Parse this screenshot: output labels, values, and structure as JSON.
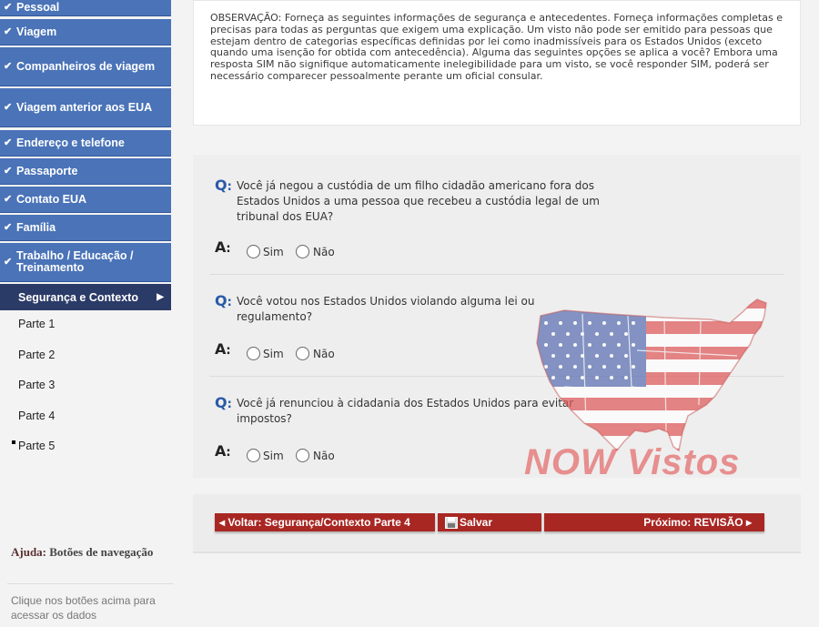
{
  "sidebar": {
    "completed": [
      {
        "label": "Pessoal"
      },
      {
        "label": "Viagem"
      },
      {
        "label": "Companheiros de viagem"
      },
      {
        "label": "Viagem anterior aos EUA"
      },
      {
        "label": "Endereço e telefone"
      },
      {
        "label": "Passaporte"
      },
      {
        "label": "Contato EUA"
      },
      {
        "label": "Família"
      },
      {
        "label": "Trabalho / Educação / Treinamento"
      }
    ],
    "check_glyph": "✔",
    "current": {
      "label": "Segurança e Contexto",
      "arrow": "▶"
    },
    "parts": [
      {
        "label": "Parte 1"
      },
      {
        "label": "Parte 2"
      },
      {
        "label": "Parte 3"
      },
      {
        "label": "Parte 4"
      },
      {
        "label": "Parte 5"
      }
    ],
    "help": {
      "title_prefix": "Ajuda:",
      "title": "Botões de navegação",
      "text": "Clique nos botões acima para acessar os dados"
    }
  },
  "observation": {
    "text": "OBSERVAÇÃO: Forneça as seguintes informações de segurança e antecedentes. Forneça informações completas e precisas para todas as perguntas que exigem uma explicação. Um visto não pode ser emitido para pessoas que estejam dentro de categorias específicas definidas por lei como inadmissíveis para os Estados Unidos (exceto quando uma isenção for obtida com antecedência). Alguma das seguintes opções se aplica a você? Embora uma resposta SIM não signifique automaticamente inelegibilidade para um visto, se você responder SIM, poderá ser necessário comparecer pessoalmente perante um oficial consular."
  },
  "questions": {
    "q_label": "Q",
    "a_label": "A",
    "colon": ":",
    "yes_label": "Sim",
    "no_label": "Não",
    "items": [
      {
        "text": "Você já negou a custódia de um filho cidadão americano fora dos Estados Unidos a uma pessoa que recebeu a custódia legal de um tribunal dos EUA?"
      },
      {
        "text": "Você votou nos Estados Unidos violando alguma lei ou regulamento?"
      },
      {
        "text": "Você já renunciou à cidadania dos Estados Unidos para evitar impostos?"
      }
    ]
  },
  "watermark": {
    "text": "NOW Vistos"
  },
  "buttons": {
    "back": "◂ Voltar: Segurança/Contexto Parte 4",
    "save": "Salvar",
    "next": "Próximo: REVISÃO ▸"
  },
  "colors": {
    "nav_done": "#4a73b8",
    "nav_current": "#2b3b68",
    "button": "#a92723",
    "q_blue": "#2a5aa8"
  }
}
